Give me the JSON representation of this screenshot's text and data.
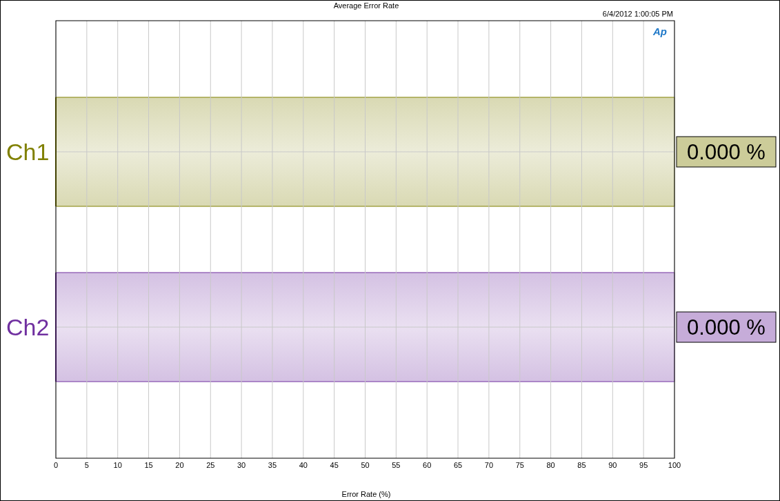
{
  "timestamp": "6/4/2012 1:00:05 PM",
  "logo": "Ap",
  "channels": [
    {
      "color": "#808000",
      "reading": "0.000 %"
    },
    {
      "color": "#7030a0",
      "reading": "0.000 %"
    }
  ],
  "chart_data": {
    "type": "bar",
    "orientation": "horizontal",
    "title": "Average Error Rate",
    "xlabel": "Error Rate (%)",
    "categories": [
      "Ch1",
      "Ch2"
    ],
    "values": [
      0,
      0
    ],
    "xlim": [
      0,
      100
    ],
    "grid": true,
    "xticks": [
      0,
      5,
      10,
      15,
      20,
      25,
      30,
      35,
      40,
      45,
      50,
      55,
      60,
      65,
      70,
      75,
      80,
      85,
      90,
      95,
      100
    ]
  }
}
